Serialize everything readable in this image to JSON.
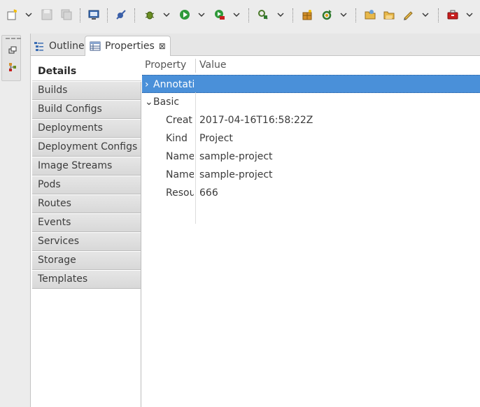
{
  "toolbar": {
    "icons": [
      "new-wizard-icon",
      "save-icon",
      "save-all-icon",
      "terminal-icon",
      "skip-breakpoints-icon",
      "debug-icon",
      "run-icon",
      "run-external-tool-icon",
      "open-type-icon",
      "new-package-icon",
      "refresh-icon",
      "open-folder-icon",
      "open-file-icon",
      "pencil-icon",
      "toolbox-icon"
    ]
  },
  "tabs": {
    "outline": "Outline",
    "properties": "Properties",
    "close_glyph": "⊠"
  },
  "categories": [
    "Details",
    "Builds",
    "Build Configs",
    "Deployments",
    "Deployment Configs",
    "Image Streams",
    "Pods",
    "Routes",
    "Events",
    "Services",
    "Storage",
    "Templates"
  ],
  "selected_category": "Details",
  "table": {
    "header_property": "Property",
    "header_value": "Value",
    "rows": [
      {
        "name": "Annotati",
        "value": "",
        "twist": "›",
        "selected": true
      },
      {
        "name": "Basic",
        "value": "",
        "twist": "⌄"
      },
      {
        "name": "Creat",
        "value": "2017-04-16T16:58:22Z"
      },
      {
        "name": "Kind",
        "value": "Project"
      },
      {
        "name": "Name",
        "value": "sample-project"
      },
      {
        "name": "Name",
        "value": "sample-project"
      },
      {
        "name": "Resou",
        "value": "666"
      }
    ]
  },
  "colors": {
    "selection": "#4a90d9",
    "background": "#ececec"
  }
}
